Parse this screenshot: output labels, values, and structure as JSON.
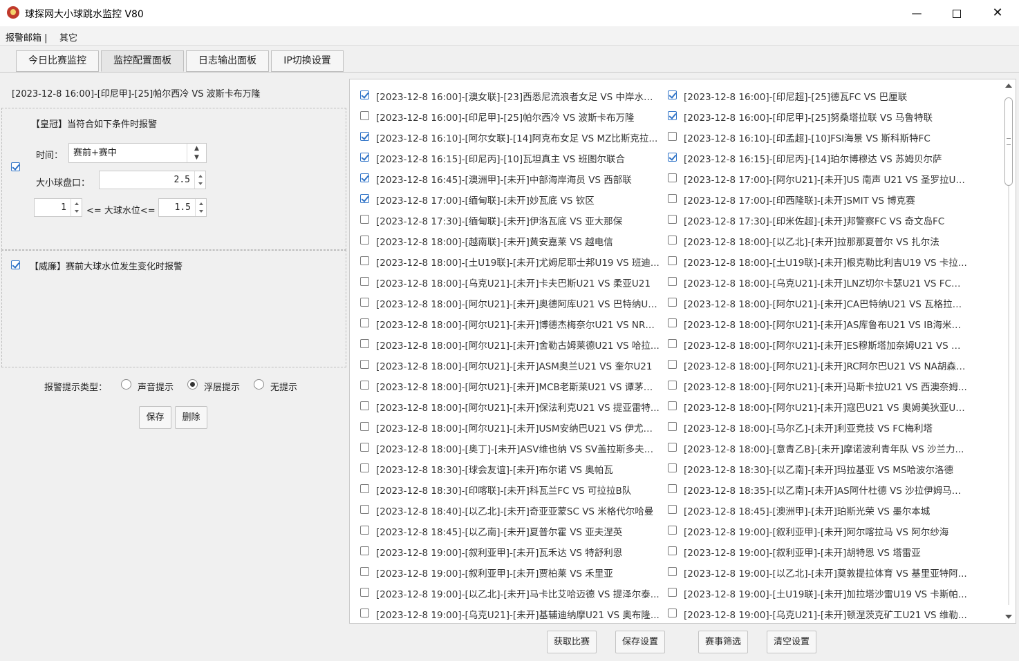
{
  "app": {
    "title": "球探网大小球跳水监控 V80"
  },
  "window_controls": {
    "minimize": "—",
    "close": "✕"
  },
  "menu": {
    "items": [
      "报警邮箱  |",
      "其它"
    ]
  },
  "tabs": [
    {
      "label": "今日比赛监控",
      "active": false
    },
    {
      "label": "监控配置面板",
      "active": true
    },
    {
      "label": "日志输出面板",
      "active": false
    },
    {
      "label": "IP切换设置",
      "active": false
    }
  ],
  "config": {
    "current_match": "[2023-12-8 16:00]-[印尼甲]-[25]帕尔西冷 VS 波斯卡布万隆",
    "crown": {
      "title": "【皇冠】当符合如下条件时报警",
      "enabled": true,
      "time_label": "时间：",
      "time_value": "赛前+赛中",
      "line_label": "大小球盘口：",
      "line_value": "2.5",
      "min_value": "1",
      "between_label": "<= 大球水位<=",
      "max_value": "1.5"
    },
    "williamhill": {
      "title": "【威廉】赛前大球水位发生变化时报警",
      "enabled": true
    },
    "alert": {
      "label": "报警提示类型：",
      "options": [
        "声音提示",
        "浮层提示",
        "无提示"
      ],
      "selected": "浮层提示"
    },
    "buttons": {
      "save": "保存",
      "delete": "删除"
    }
  },
  "matches_left": [
    {
      "text": "[2023-12-8 16:00]-[澳女联]-[23]西悉尼流浪者女足 VS 中岸水手...",
      "checked": true
    },
    {
      "text": "[2023-12-8 16:00]-[印尼甲]-[25]帕尔西冷 VS 波斯卡布万隆",
      "checked": false
    },
    {
      "text": "[2023-12-8 16:10]-[阿尔女联]-[14]阿克布女足 VS MZ比斯克拉...",
      "checked": true
    },
    {
      "text": "[2023-12-8 16:15]-[印尼丙]-[10]瓦坦真主 VS 班图尔联合",
      "checked": true
    },
    {
      "text": "[2023-12-8 16:45]-[澳洲甲]-[未开]中部海岸海员 VS 西部联",
      "checked": true
    },
    {
      "text": "[2023-12-8 17:00]-[缅甸联]-[未开]妙瓦底 VS 钦区",
      "checked": true
    },
    {
      "text": "[2023-12-8 17:30]-[缅甸联]-[未开]伊洛瓦底 VS 亚大那保",
      "checked": false
    },
    {
      "text": "[2023-12-8 18:00]-[越南联]-[未开]黄安嘉莱 VS 越电信",
      "checked": false
    },
    {
      "text": "[2023-12-8 18:00]-[土U19联]-[未开]尤姆尼耶士邦U19 VS 班迪...",
      "checked": false
    },
    {
      "text": "[2023-12-8 18:00]-[乌克U21]-[未开]卡夫巴斯U21 VS 柔亚U21",
      "checked": false
    },
    {
      "text": "[2023-12-8 18:00]-[阿尔U21]-[未开]奥德阿库U21 VS 巴特纳U21",
      "checked": false
    },
    {
      "text": "[2023-12-8 18:00]-[阿尔U21]-[未开]博德杰梅奈尔U21 VS NRB...",
      "checked": false
    },
    {
      "text": "[2023-12-8 18:00]-[阿尔U21]-[未开]舍勒古姆莱德U21 VS 哈拉...",
      "checked": false
    },
    {
      "text": "[2023-12-8 18:00]-[阿尔U21]-[未开]ASM奥兰U21 VS 奎尔U21",
      "checked": false
    },
    {
      "text": "[2023-12-8 18:00]-[阿尔U21]-[未开]MCB老斯莱U21 VS 谭茅芩...",
      "checked": false
    },
    {
      "text": "[2023-12-8 18:00]-[阿尔U21]-[未开]保法利克U21 VS 提亚雷特...",
      "checked": false
    },
    {
      "text": "[2023-12-8 18:00]-[阿尔U21]-[未开]USM安纳巴U21 VS 伊尤马...",
      "checked": false
    },
    {
      "text": "[2023-12-8 18:00]-[奥丁]-[未开]ASV维也纳 VS SV盖拉斯多夫结...",
      "checked": false
    },
    {
      "text": "[2023-12-8 18:30]-[球会友谊]-[未开]布尔诺 VS 奥帕瓦",
      "checked": false
    },
    {
      "text": "[2023-12-8 18:30]-[印喀联]-[未开]科瓦兰FC VS 可拉拉B队",
      "checked": false
    },
    {
      "text": "[2023-12-8 18:40]-[以乙北]-[未开]奇亚亚蒙SC VS 米格代尔哈曼",
      "checked": false
    },
    {
      "text": "[2023-12-8 18:45]-[以乙南]-[未开]夏普尔霍 VS 亚夫涅英",
      "checked": false
    },
    {
      "text": "[2023-12-8 19:00]-[叙利亚甲]-[未开]瓦禾达 VS 特舒利恩",
      "checked": false
    },
    {
      "text": "[2023-12-8 19:00]-[叙利亚甲]-[未开]贾柏莱 VS 禾里亚",
      "checked": false
    },
    {
      "text": "[2023-12-8 19:00]-[以乙北]-[未开]马卡比艾哈迈德 VS 提泽尔泰...",
      "checked": false
    },
    {
      "text": "[2023-12-8 19:00]-[乌克U21]-[未开]基辅迪纳摩U21 VS 奥布隆...",
      "checked": false
    }
  ],
  "matches_right": [
    {
      "text": "[2023-12-8 16:00]-[印尼超]-[25]德瓦FC VS 巴厘联",
      "checked": true
    },
    {
      "text": "[2023-12-8 16:00]-[印尼甲]-[25]努桑塔拉联 VS 马鲁特联",
      "checked": true
    },
    {
      "text": "[2023-12-8 16:10]-[印孟超]-[10]FSI海景 VS 斯科斯特FC",
      "checked": false
    },
    {
      "text": "[2023-12-8 16:15]-[印尼丙]-[14]珀尔博穆达 VS 苏姆贝尔萨",
      "checked": true
    },
    {
      "text": "[2023-12-8 17:00]-[阿尔U21]-[未开]US 南声 U21 VS 圣罗拉U21",
      "checked": false
    },
    {
      "text": "[2023-12-8 17:00]-[印西隆联]-[未开]SMIT VS 博克赛",
      "checked": false
    },
    {
      "text": "[2023-12-8 17:30]-[印米佐超]-[未开]邦警察FC VS 奇文岛FC",
      "checked": false
    },
    {
      "text": "[2023-12-8 18:00]-[以乙北]-[未开]拉那那夏普尔 VS 扎尔法",
      "checked": false
    },
    {
      "text": "[2023-12-8 18:00]-[土U19联]-[未开]根克勒比利吉U19 VS 卡拉...",
      "checked": false
    },
    {
      "text": "[2023-12-8 18:00]-[乌克U21]-[未开]LNZ切尔卡瑟U21 VS FC米...",
      "checked": false
    },
    {
      "text": "[2023-12-8 18:00]-[阿尔U21]-[未开]CA巴特纳U21 VS 瓦格拉U21",
      "checked": false
    },
    {
      "text": "[2023-12-8 18:00]-[阿尔U21]-[未开]AS库鲁布U21 VS IB海米斯...",
      "checked": false
    },
    {
      "text": "[2023-12-8 18:00]-[阿尔U21]-[未开]ES穆斯塔加奈姆U21 VS 克...",
      "checked": false
    },
    {
      "text": "[2023-12-8 18:00]-[阿尔U21]-[未开]RC阿尔巴U21 VS NA胡森U...",
      "checked": false
    },
    {
      "text": "[2023-12-8 18:00]-[阿尔U21]-[未开]马斯卡拉U21 VS 西澳奈姆...",
      "checked": false
    },
    {
      "text": "[2023-12-8 18:00]-[阿尔U21]-[未开]寇巴U21 VS 奥姆美狄亚U21",
      "checked": false
    },
    {
      "text": "[2023-12-8 18:00]-[马尔乙]-[未开]利亚竞技 VS FC梅利塔",
      "checked": false
    },
    {
      "text": "[2023-12-8 18:00]-[意青乙B]-[未开]摩诺波利青年队 VS 沙兰力...",
      "checked": false
    },
    {
      "text": "[2023-12-8 18:30]-[以乙南]-[未开]玛拉基亚 VS MS哈波尔洛德",
      "checked": false
    },
    {
      "text": "[2023-12-8 18:35]-[以乙南]-[未开]AS阿什杜德 VS 沙拉伊姆马卡...",
      "checked": false
    },
    {
      "text": "[2023-12-8 18:45]-[澳洲甲]-[未开]珀斯光荣 VS 墨尔本城",
      "checked": false
    },
    {
      "text": "[2023-12-8 19:00]-[叙利亚甲]-[未开]阿尔喀拉马 VS 阿尔纱海",
      "checked": false
    },
    {
      "text": "[2023-12-8 19:00]-[叙利亚甲]-[未开]胡特恩 VS 塔雷亚",
      "checked": false
    },
    {
      "text": "[2023-12-8 19:00]-[以乙北]-[未开]莫敦提拉体育 VS 基里亚特阿...",
      "checked": false
    },
    {
      "text": "[2023-12-8 19:00]-[土U19联]-[未开]加拉塔沙雷U19 VS 卡斯帕...",
      "checked": false
    },
    {
      "text": "[2023-12-8 19:00]-[乌克U21]-[未开]顿涅茨克矿工U21 VS 维勒...",
      "checked": false
    }
  ],
  "bottom_buttons": {
    "fetch": "获取比赛",
    "save_settings": "保存设置",
    "filter": "赛事筛选",
    "clear": "清空设置"
  }
}
